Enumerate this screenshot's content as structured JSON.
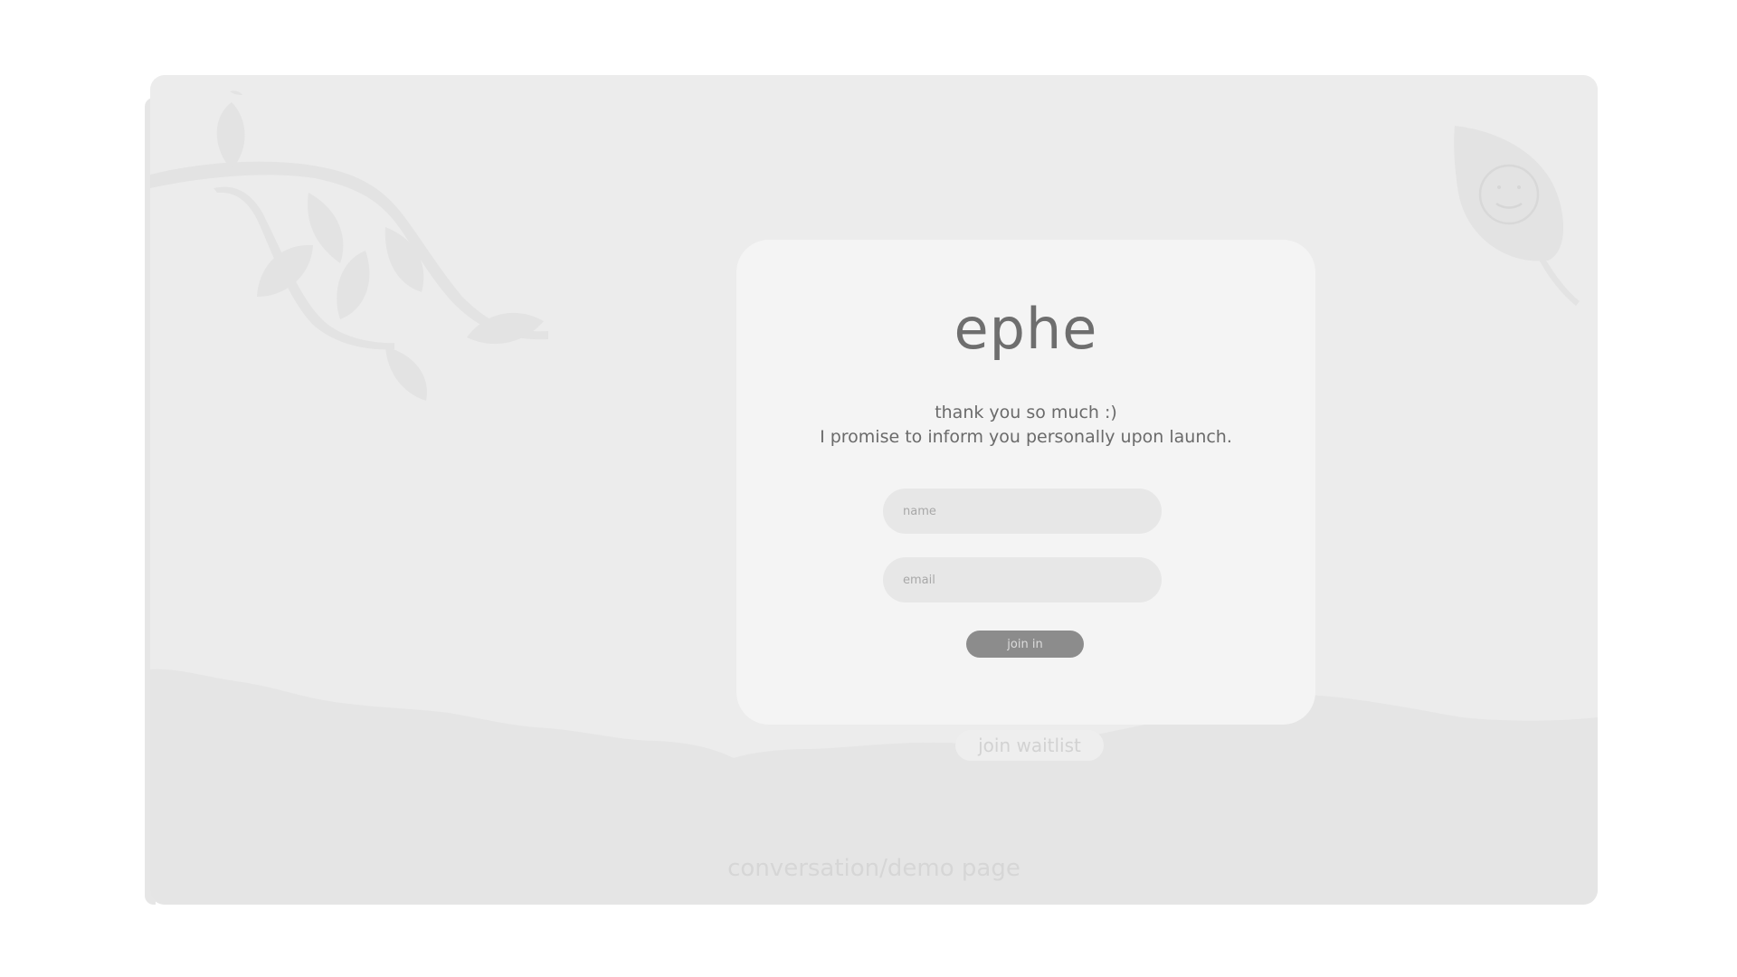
{
  "brand": {
    "title": "ephe"
  },
  "card": {
    "message_line1": "thank you so much :)",
    "message_line2": "I promise to inform you personally upon launch."
  },
  "form": {
    "name_placeholder": "name",
    "name_value": "",
    "email_placeholder": "email",
    "email_value": "",
    "submit_label": "join in"
  },
  "footer": {
    "waitlist_label": "join waitlist",
    "demo_link_label": "conversation/demo page"
  },
  "colors": {
    "page_background": "#ffffff",
    "frame_background": "#ececec",
    "card_background": "#f4f4f4",
    "field_background": "#e7e7e7",
    "button_background": "#8c8c8c",
    "text_primary": "#6e6e6e"
  }
}
